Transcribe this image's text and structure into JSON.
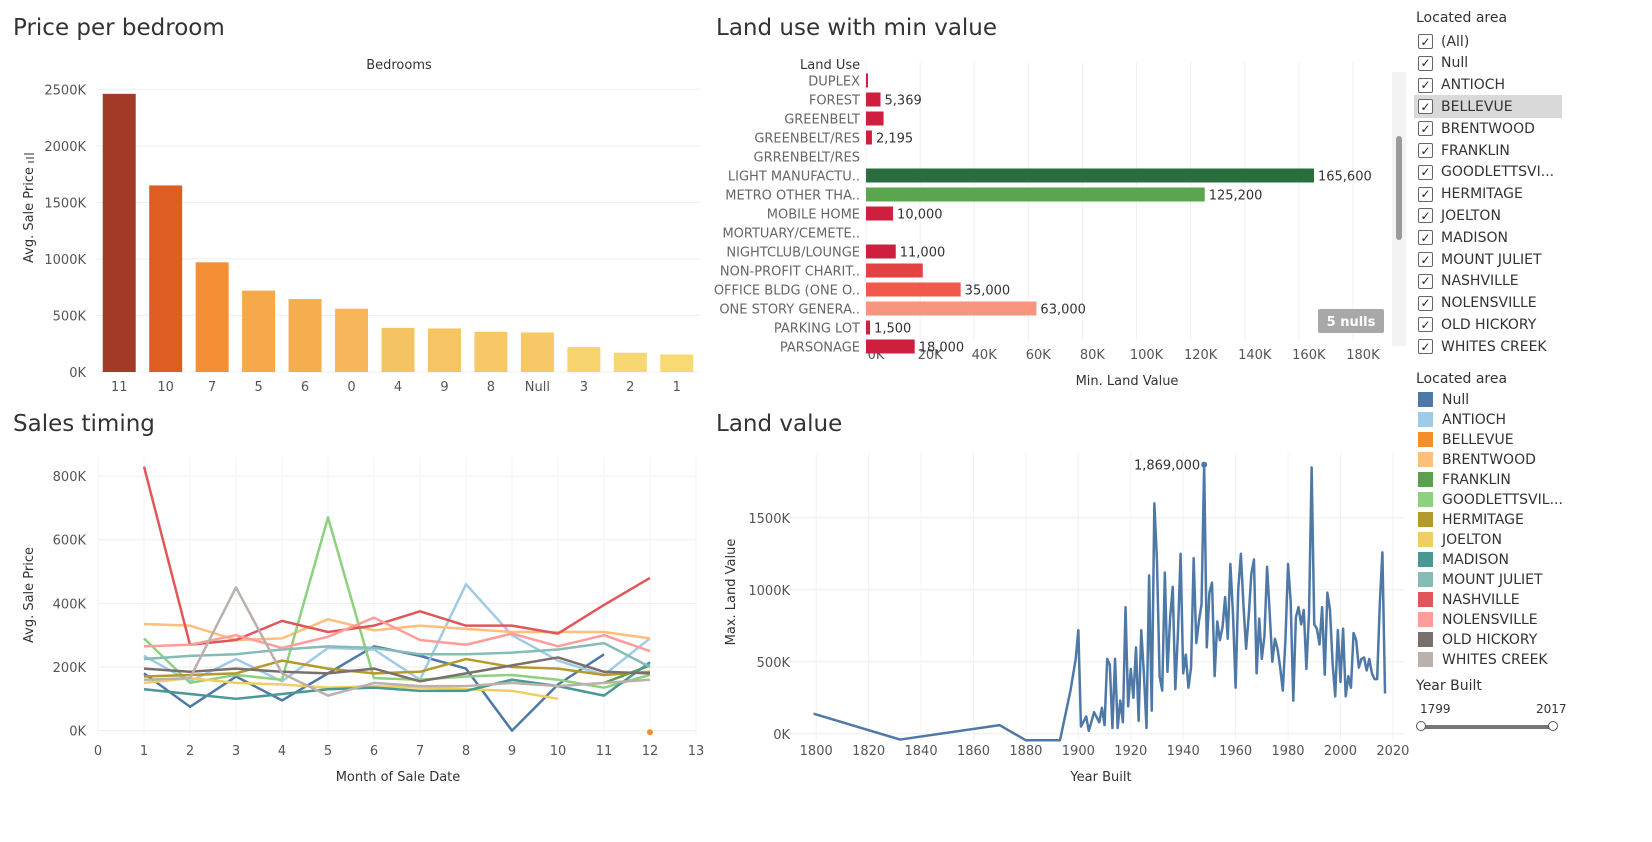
{
  "colors": {
    "bars_price": [
      "#a13a26",
      "#de5d23",
      "#f58f36",
      "#f6a84b",
      "#f6ad50",
      "#f7b65a",
      "#f5c462",
      "#f6c463",
      "#f6c866",
      "#f6c866",
      "#f6d36d",
      "#f7d773",
      "#f8da75"
    ],
    "land_red": "#ce1f3f",
    "land_green_dark": "#2a6e3f",
    "land_green": "#5aa64f",
    "land_red_medium": "#e24242",
    "land_red_light": "#f2594d",
    "land_salmon": "#f79480",
    "line_blue": "#4e79a7",
    "grid": "#eeeeee"
  },
  "panels": {
    "price_per_bedroom": "Price per bedroom",
    "land_use_min": "Land use with min value",
    "sales_timing": "Sales timing",
    "land_value": "Land value"
  },
  "sidebar": {
    "filter_title": "Located area",
    "filter_items": [
      {
        "label": "(All)",
        "checked": true
      },
      {
        "label": "Null",
        "checked": true
      },
      {
        "label": "ANTIOCH",
        "checked": true
      },
      {
        "label": "BELLEVUE",
        "checked": true,
        "highlighted": true
      },
      {
        "label": "BRENTWOOD",
        "checked": true
      },
      {
        "label": "FRANKLIN",
        "checked": true
      },
      {
        "label": "GOODLETTSVI...",
        "checked": true
      },
      {
        "label": "HERMITAGE",
        "checked": true
      },
      {
        "label": "JOELTON",
        "checked": true
      },
      {
        "label": "MADISON",
        "checked": true
      },
      {
        "label": "MOUNT JULIET",
        "checked": true
      },
      {
        "label": "NASHVILLE",
        "checked": true
      },
      {
        "label": "NOLENSVILLE",
        "checked": true
      },
      {
        "label": "OLD HICKORY",
        "checked": true
      },
      {
        "label": "WHITES CREEK",
        "checked": true
      }
    ],
    "legend_title": "Located area",
    "legend_items": [
      {
        "label": "Null",
        "color": "#4e79a7"
      },
      {
        "label": "ANTIOCH",
        "color": "#a0cbe8"
      },
      {
        "label": "BELLEVUE",
        "color": "#f28e2b"
      },
      {
        "label": "BRENTWOOD",
        "color": "#ffbe7d"
      },
      {
        "label": "FRANKLIN",
        "color": "#59a14f"
      },
      {
        "label": "GOODLETTSVIL...",
        "color": "#8cd17d"
      },
      {
        "label": "HERMITAGE",
        "color": "#b6992d"
      },
      {
        "label": "JOELTON",
        "color": "#f1ce63"
      },
      {
        "label": "MADISON",
        "color": "#499894"
      },
      {
        "label": "MOUNT JULIET",
        "color": "#86bcb6"
      },
      {
        "label": "NASHVILLE",
        "color": "#e15759"
      },
      {
        "label": "NOLENSVILLE",
        "color": "#ff9d9a"
      },
      {
        "label": "OLD HICKORY",
        "color": "#79706e"
      },
      {
        "label": "WHITES CREEK",
        "color": "#bab0ac"
      }
    ],
    "year_built": {
      "title": "Year Built",
      "min": "1799",
      "max": "2017"
    }
  },
  "chart_data": [
    {
      "id": "price_per_bedroom",
      "type": "bar",
      "title": "Price per bedroom",
      "header": "Bedrooms",
      "ylabel": "Avg. Sale Price",
      "categories": [
        "11",
        "10",
        "7",
        "5",
        "6",
        "0",
        "4",
        "9",
        "8",
        "Null",
        "3",
        "2",
        "1"
      ],
      "values": [
        2460,
        1650,
        970,
        720,
        645,
        560,
        390,
        385,
        355,
        350,
        220,
        170,
        155
      ],
      "unit": "K",
      "ylim": [
        0,
        2600
      ],
      "yticks": [
        0,
        500,
        1000,
        1500,
        2000,
        2500
      ],
      "ytick_labels": [
        "0K",
        "500K",
        "1000K",
        "1500K",
        "2000K",
        "2500K"
      ]
    },
    {
      "id": "land_use_min",
      "type": "bar",
      "orientation": "horizontal",
      "title": "Land use with min value",
      "row_header": "Land Use",
      "xlabel": "Min. Land Value",
      "categories": [
        "DUPLEX",
        "FOREST",
        "GREENBELT",
        "GREENBELT/RES",
        "GRRENBELT/RES",
        "LIGHT MANUFACTU..",
        "METRO OTHER THA..",
        "MOBILE HOME",
        "MORTUARY/CEMETE..",
        "NIGHTCLUB/LOUNGE",
        "NON-PROFIT CHARIT..",
        "OFFICE BLDG (ONE O..",
        "ONE STORY GENERA..",
        "PARKING LOT",
        "PARSONAGE"
      ],
      "values": [
        700,
        5369,
        6500,
        2195,
        null,
        165600,
        125200,
        10000,
        null,
        11000,
        21000,
        35000,
        63000,
        1500,
        18000
      ],
      "value_labels": [
        "",
        "5,369",
        "",
        "2,195",
        "",
        "165,600",
        "125,200",
        "10,000",
        "",
        "11,000",
        "",
        "35,000",
        "63,000",
        "1,500",
        "18,000"
      ],
      "xlim": [
        0,
        190000
      ],
      "xticks": [
        0,
        20000,
        40000,
        60000,
        80000,
        100000,
        120000,
        140000,
        160000,
        180000
      ],
      "xtick_labels": [
        "0K",
        "20K",
        "40K",
        "60K",
        "80K",
        "100K",
        "120K",
        "140K",
        "160K",
        "180K"
      ],
      "nulls_badge": "5 nulls"
    },
    {
      "id": "sales_timing",
      "type": "line",
      "title": "Sales timing",
      "xlabel": "Month of Sale Date",
      "ylabel": "Avg. Sale Price",
      "xlim": [
        0,
        13
      ],
      "xticks": [
        0,
        1,
        2,
        3,
        4,
        5,
        6,
        7,
        8,
        9,
        10,
        11,
        12,
        13
      ],
      "ylim": [
        -20,
        860
      ],
      "yticks": [
        0,
        200,
        400,
        600,
        800
      ],
      "ytick_labels": [
        "0K",
        "200K",
        "400K",
        "600K",
        "800K"
      ],
      "series": [
        {
          "name": "Null",
          "color": "#4e79a7",
          "x": [
            1,
            2,
            3,
            4,
            5,
            6,
            7,
            8,
            9,
            10,
            11
          ],
          "y": [
            180,
            75,
            170,
            95,
            180,
            265,
            235,
            195,
            0,
            145,
            240
          ]
        },
        {
          "name": "ANTIOCH",
          "color": "#a0cbe8",
          "x": [
            1,
            2,
            3,
            4,
            5,
            6,
            7,
            8,
            9,
            10,
            11,
            12
          ],
          "y": [
            235,
            155,
            225,
            155,
            260,
            255,
            160,
            460,
            300,
            220,
            175,
            290
          ]
        },
        {
          "name": "BELLEVUE",
          "color": "#f28e2b",
          "x": [
            12
          ],
          "y": [
            -5
          ]
        },
        {
          "name": "BRENTWOOD",
          "color": "#ffbe7d",
          "x": [
            1,
            2,
            3,
            4,
            5,
            6,
            7,
            8,
            9,
            10,
            11,
            12
          ],
          "y": [
            335,
            330,
            285,
            290,
            350,
            315,
            330,
            320,
            310,
            310,
            310,
            290
          ]
        },
        {
          "name": "FRANKLIN",
          "color": "#59a14f",
          "x": [
            11,
            12
          ],
          "y": [
            150,
            205
          ]
        },
        {
          "name": "GOODLETTSVILLE",
          "color": "#8cd17d",
          "x": [
            1,
            2,
            3,
            4,
            5,
            6,
            7,
            8,
            9,
            10,
            11,
            12
          ],
          "y": [
            290,
            150,
            175,
            160,
            670,
            165,
            160,
            170,
            175,
            160,
            135,
            175
          ]
        },
        {
          "name": "HERMITAGE",
          "color": "#b6992d",
          "x": [
            1,
            2,
            3,
            4,
            5,
            6,
            7,
            8,
            9,
            10,
            11,
            12
          ],
          "y": [
            170,
            175,
            180,
            220,
            195,
            180,
            185,
            225,
            200,
            195,
            175,
            185
          ]
        },
        {
          "name": "JOELTON",
          "color": "#f1ce63",
          "x": [
            1,
            2,
            3,
            4,
            5,
            6,
            7,
            8,
            9,
            10
          ],
          "y": [
            150,
            165,
            150,
            145,
            135,
            140,
            135,
            130,
            125,
            100
          ]
        },
        {
          "name": "MADISON",
          "color": "#499894",
          "x": [
            1,
            2,
            3,
            4,
            5,
            6,
            7,
            8,
            9,
            10,
            11,
            12
          ],
          "y": [
            130,
            115,
            100,
            115,
            130,
            135,
            125,
            125,
            160,
            140,
            110,
            215
          ]
        },
        {
          "name": "MOUNT JULIET",
          "color": "#86bcb6",
          "x": [
            1,
            2,
            3,
            4,
            5,
            6,
            7,
            8,
            9,
            10,
            11,
            12
          ],
          "y": [
            225,
            235,
            240,
            255,
            265,
            260,
            240,
            240,
            245,
            255,
            275,
            200
          ]
        },
        {
          "name": "NASHVILLE",
          "color": "#e15759",
          "x": [
            1,
            2,
            3,
            4,
            5,
            6,
            7,
            8,
            9,
            10,
            11,
            12
          ],
          "y": [
            830,
            270,
            285,
            345,
            310,
            330,
            375,
            330,
            330,
            305,
            395,
            480
          ]
        },
        {
          "name": "NOLENSVILLE",
          "color": "#ff9d9a",
          "x": [
            1,
            2,
            3,
            4,
            5,
            6,
            7,
            8,
            9,
            10,
            11,
            12
          ],
          "y": [
            265,
            270,
            300,
            260,
            295,
            355,
            285,
            270,
            305,
            265,
            300,
            250
          ]
        },
        {
          "name": "OLD HICKORY",
          "color": "#79706e",
          "x": [
            1,
            2,
            3,
            4,
            5,
            6,
            7,
            8,
            9,
            10,
            11,
            12
          ],
          "y": [
            195,
            185,
            195,
            185,
            180,
            195,
            155,
            180,
            205,
            230,
            185,
            180
          ]
        },
        {
          "name": "WHITES CREEK",
          "color": "#bab0ac",
          "x": [
            1,
            2,
            3,
            4,
            5,
            6,
            7,
            8,
            9,
            10,
            11,
            12
          ],
          "y": [
            160,
            165,
            450,
            180,
            110,
            150,
            140,
            140,
            150,
            140,
            150,
            160
          ]
        }
      ]
    },
    {
      "id": "land_value",
      "type": "line",
      "title": "Land value",
      "xlabel": "Year Built",
      "ylabel": "Max. Land Value",
      "xlim": [
        1790,
        2025
      ],
      "xticks": [
        1800,
        1820,
        1840,
        1860,
        1880,
        1900,
        1920,
        1940,
        1960,
        1980,
        2000,
        2020
      ],
      "ylim": [
        -50,
        1950
      ],
      "yticks": [
        0,
        500,
        1000,
        1500
      ],
      "ytick_labels": [
        "0K",
        "500K",
        "1000K",
        "1500K"
      ],
      "annotation": {
        "x": 1948,
        "y": 1869,
        "label": "1,869,000"
      },
      "series": [
        {
          "name": "Null",
          "color": "#4e79a7",
          "x": [
            1799,
            1832,
            1870,
            1880,
            1893,
            1897,
            1899,
            1900,
            1901,
            1903,
            1904,
            1906,
            1908,
            1909,
            1910,
            1911,
            1912,
            1913,
            1914,
            1915,
            1916,
            1917,
            1918,
            1919,
            1920,
            1921,
            1922,
            1923,
            1924,
            1925,
            1926,
            1927,
            1928,
            1929,
            1930,
            1931,
            1932,
            1933,
            1934,
            1935,
            1936,
            1937,
            1938,
            1939,
            1940,
            1941,
            1942,
            1943,
            1944,
            1945,
            1946,
            1947,
            1948,
            1949,
            1950,
            1951,
            1952,
            1953,
            1954,
            1955,
            1956,
            1957,
            1958,
            1959,
            1960,
            1961,
            1962,
            1963,
            1964,
            1965,
            1966,
            1967,
            1968,
            1969,
            1970,
            1971,
            1972,
            1973,
            1974,
            1975,
            1976,
            1977,
            1978,
            1979,
            1980,
            1981,
            1982,
            1983,
            1984,
            1985,
            1986,
            1987,
            1988,
            1989,
            1990,
            1991,
            1992,
            1993,
            1994,
            1995,
            1996,
            1997,
            1998,
            1999,
            2000,
            2001,
            2002,
            2003,
            2004,
            2005,
            2006,
            2007,
            2008,
            2009,
            2010,
            2011,
            2012,
            2013,
            2014,
            2015,
            2016,
            2017
          ],
          "y": [
            140,
            -40,
            60,
            -45,
            -45,
            300,
            520,
            720,
            50,
            120,
            20,
            150,
            80,
            180,
            60,
            520,
            480,
            40,
            520,
            40,
            230,
            80,
            880,
            190,
            450,
            250,
            600,
            90,
            720,
            420,
            40,
            1100,
            160,
            1600,
            1200,
            400,
            300,
            1120,
            430,
            800,
            1020,
            310,
            700,
            1250,
            420,
            550,
            320,
            460,
            1220,
            630,
            780,
            900,
            1869,
            600,
            980,
            1050,
            400,
            780,
            650,
            740,
            950,
            660,
            1180,
            830,
            320,
            1000,
            1250,
            890,
            590,
            820,
            1110,
            1210,
            420,
            800,
            520,
            680,
            1160,
            840,
            500,
            660,
            590,
            460,
            300,
            650,
            1180,
            920,
            230,
            810,
            880,
            760,
            860,
            450,
            830,
            1850,
            760,
            730,
            620,
            880,
            410,
            980,
            860,
            490,
            260,
            720,
            360,
            730,
            260,
            400,
            320,
            700,
            650,
            460,
            520,
            530,
            440,
            520,
            420,
            380,
            380,
            900,
            1260,
            280
          ]
        }
      ]
    }
  ]
}
